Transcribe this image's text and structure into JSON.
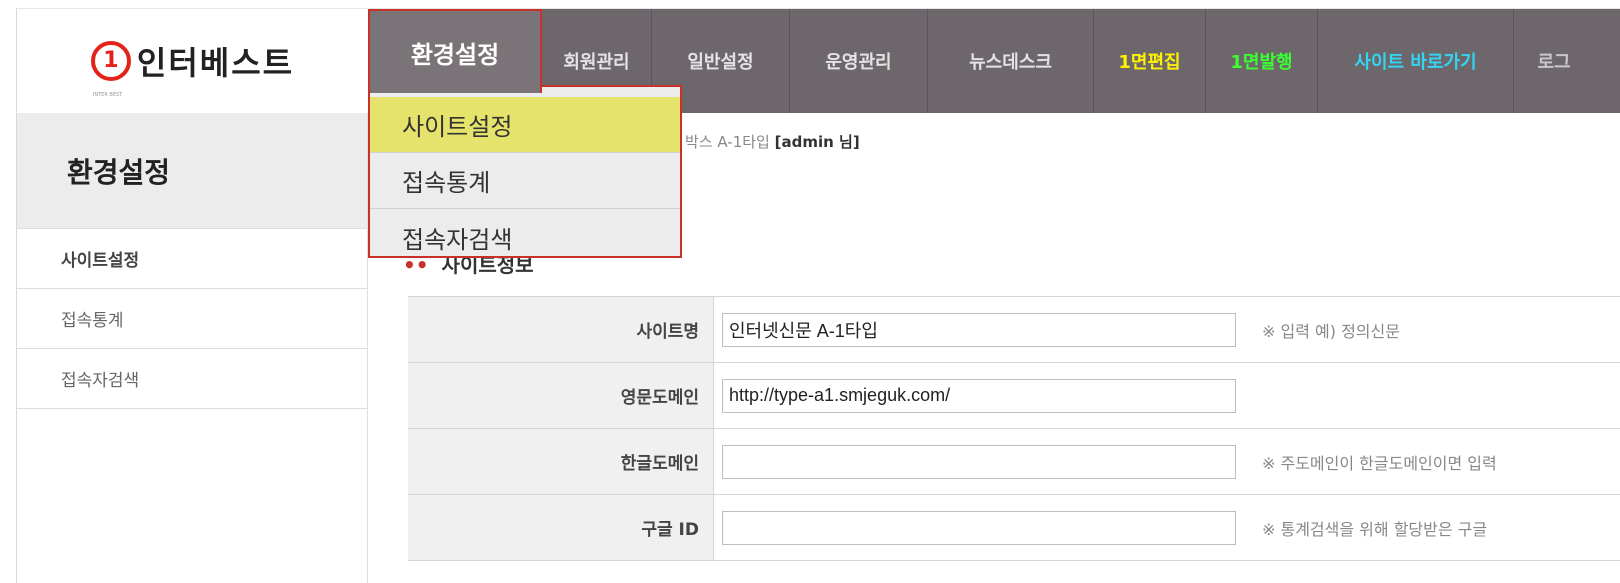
{
  "logo": {
    "mark": "1",
    "text": "인터베스트",
    "sub": "INTER BEST"
  },
  "nav": {
    "items": [
      {
        "label": "회원관리"
      },
      {
        "label": "일반설정"
      },
      {
        "label": "운영관리"
      },
      {
        "label": "뉴스데스크"
      },
      {
        "label": "1면편집"
      },
      {
        "label": "1면발행"
      },
      {
        "label": "사이트 바로가기"
      },
      {
        "label": "로그"
      }
    ]
  },
  "dropdown": {
    "tab": "환경설정",
    "items": [
      {
        "label": "사이트설정"
      },
      {
        "label": "접속통계"
      },
      {
        "label": "접속자검색"
      }
    ]
  },
  "sidebar": {
    "title": "환경설정",
    "items": [
      {
        "label": "사이트설정"
      },
      {
        "label": "접속통계"
      },
      {
        "label": "접속자검색"
      }
    ]
  },
  "breadcrumb": {
    "text": "박스 A-1타입",
    "user": "[admin 님]"
  },
  "section": {
    "title": "사이트정보",
    "mark": "••"
  },
  "form": {
    "rows": [
      {
        "label": "사이트명",
        "value": "인터넷신문 A-1타입",
        "hint": "※ 입력 예) 정의신문"
      },
      {
        "label": "영문도메인",
        "value": "http://type-a1.smjeguk.com/",
        "hint": ""
      },
      {
        "label": "한글도메인",
        "value": "",
        "hint": "※ 주도메인이 한글도메인이면 입력"
      },
      {
        "label": "구글 ID",
        "value": "",
        "hint": "※ 통계검색을 위해 할당받은 구글"
      }
    ]
  },
  "colors": {
    "nav_bg": "#6d676c",
    "accent_red": "#c8302a",
    "highlight": "#e5e36b"
  }
}
